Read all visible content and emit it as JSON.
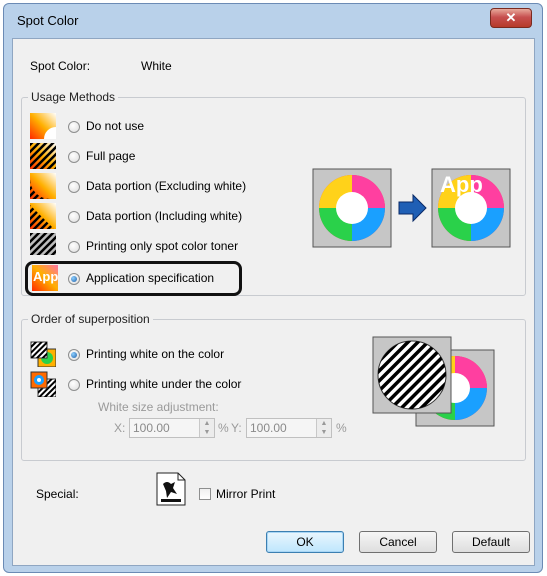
{
  "window": {
    "title": "Spot Color",
    "close_glyph": "✕"
  },
  "spot_color": {
    "label": "Spot Color:",
    "value": "White"
  },
  "usage": {
    "legend": "Usage Methods",
    "options": [
      {
        "label": "Do not use",
        "icon": "gradient-icon",
        "checked": false
      },
      {
        "label": "Full page",
        "icon": "hatched-full-icon",
        "checked": false
      },
      {
        "label": "Data portion (Excluding white)",
        "icon": "hatched-exclude-icon",
        "checked": false
      },
      {
        "label": "Data portion (Including white)",
        "icon": "hatched-include-icon",
        "checked": false
      },
      {
        "label": "Printing only spot color toner",
        "icon": "hatched-gray-icon",
        "checked": false
      },
      {
        "label": "Application specification",
        "icon": "app-icon",
        "checked": true
      }
    ],
    "app_badge": "App"
  },
  "superposition": {
    "legend": "Order of superposition",
    "options": [
      {
        "label": "Printing white on the color",
        "checked": true
      },
      {
        "label": "Printing white under the color",
        "checked": false
      }
    ],
    "white_size_label": "White size adjustment:",
    "x_label": "X:",
    "x_value": "100.00",
    "x_unit": "%",
    "y_label": "Y:",
    "y_value": "100.00",
    "y_unit": "%"
  },
  "special": {
    "label": "Special:",
    "mirror_label": "Mirror Print",
    "mirror_checked": false
  },
  "buttons": {
    "ok": "OK",
    "cancel": "Cancel",
    "default": "Default"
  }
}
